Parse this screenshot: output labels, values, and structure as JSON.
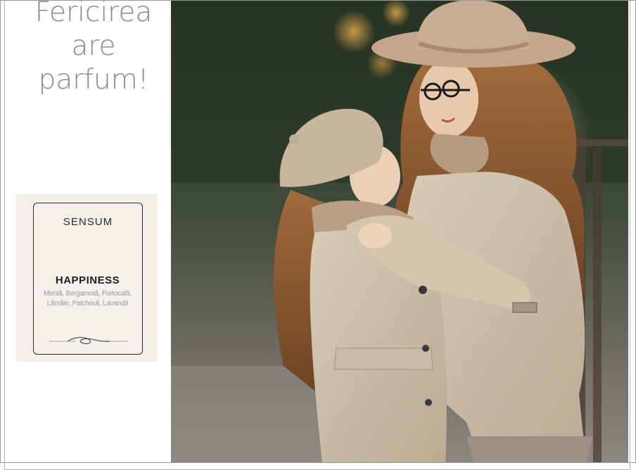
{
  "headline": {
    "line1": "Fericirea",
    "line2": "are",
    "line3": "parfum!"
  },
  "product": {
    "brand": "SENSUM",
    "name": "HAPPINESS",
    "notes_line1": "Mentă, Bergamotă, Portocală,",
    "notes_line2": "Lămâie, Patchouli, Lavandă"
  },
  "photo": {
    "subject": "two-girls-hugging-photo"
  },
  "colors": {
    "headline": "#8a8a8a",
    "card_bg": "#f2efe8",
    "text_dark": "#1f1f1f"
  }
}
